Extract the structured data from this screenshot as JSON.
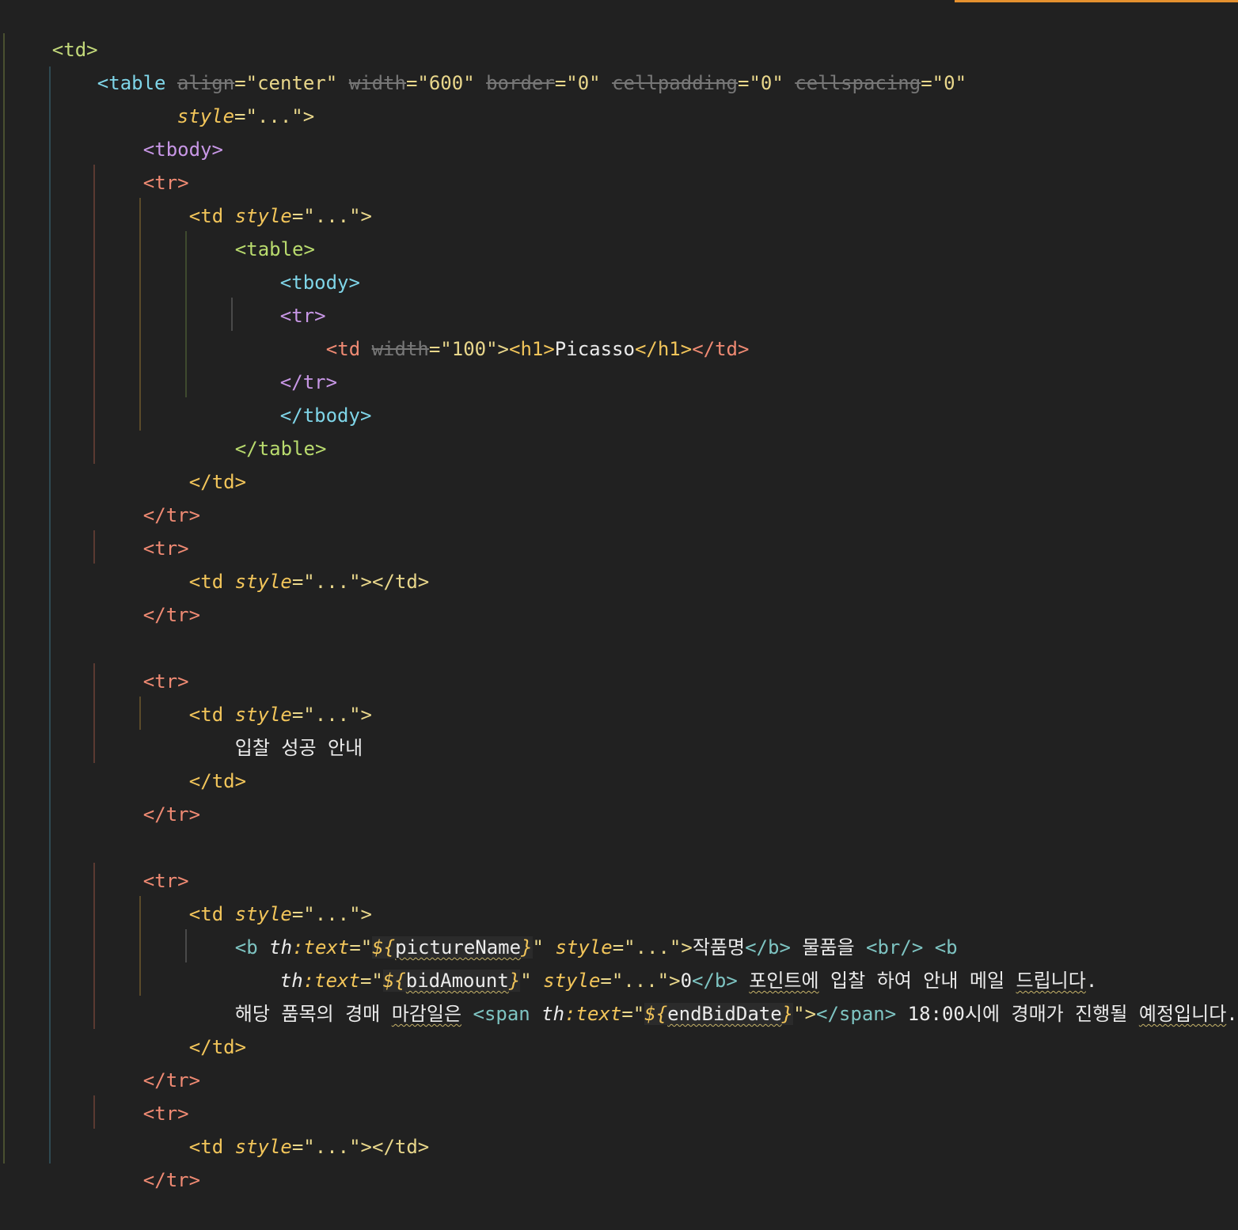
{
  "editor": {
    "lines": {
      "l1": "<td>",
      "l2a": "<table ",
      "l2b": "align",
      "l2c": "=\"center\" ",
      "l2d": "width",
      "l2e": "=\"600\" ",
      "l2f": "border",
      "l2g": "=\"0\" ",
      "l2h": "cellpadding",
      "l2i": "=\"0\" ",
      "l2j": "cellspacing",
      "l2k": "=\"0\"",
      "l3a": "style",
      "l3b": "=\"...\">",
      "l4": "<tbody>",
      "l5": "<tr>",
      "l6a": "<td ",
      "l6b": "style",
      "l6c": "=\"...\">",
      "l7": "<table>",
      "l8": "<tbody>",
      "l9": "<tr>",
      "l10a": "<td ",
      "l10b": "width",
      "l10c": "=\"100\">",
      "l10d": "<h1>",
      "l10e": "Picasso",
      "l10f": "</h1>",
      "l10g": "</td>",
      "l11": "</tr>",
      "l12": "</tbody>",
      "l13": "</table>",
      "l14": "</td>",
      "l15": "</tr>",
      "l16": "<tr>",
      "l17a": "<td ",
      "l17b": "style",
      "l17c": "=\"...\"></td>",
      "l18": "</tr>",
      "l19": "<tr>",
      "l20a": "<td ",
      "l20b": "style",
      "l20c": "=\"...\">",
      "l21": "입찰 성공 안내",
      "l22": "</td>",
      "l23": "</tr>",
      "l24": "<tr>",
      "l25a": "<td ",
      "l25b": "style",
      "l25c": "=\"...\">",
      "l26a": "<b ",
      "l26b": "th",
      "l26c": ":text",
      "l26d": "=\"",
      "l26e": "${",
      "l26f": "pictureName",
      "l26g": "}",
      "l26h": "\" ",
      "l26i": "style",
      "l26j": "=\"...\">",
      "l26k": "작품명",
      "l26l": "</b>",
      "l26m": " 물품을 ",
      "l26n": "<br/>",
      "l26o": " <b",
      "l27a": "th",
      "l27b": ":text",
      "l27c": "=\"",
      "l27d": "${",
      "l27e": "bidAmount",
      "l27f": "}",
      "l27g": "\" ",
      "l27h": "style",
      "l27i": "=\"...\">",
      "l27j": "0",
      "l27k": "</b>",
      "l27l": " ",
      "l27m": "포인트에",
      "l27n": " 입찰 하여 안내 메일 ",
      "l27o": "드립니다",
      "l27p": ".",
      "l28a": "해당 품목의 경매 ",
      "l28b": "마감일은",
      "l28c": " ",
      "l28d": "<span ",
      "l28e": "th",
      "l28f": ":text",
      "l28g": "=\"",
      "l28h": "${",
      "l28i": "endBidDate",
      "l28j": "}",
      "l28k": "\">",
      "l28l": "</span>",
      "l28m": " 18:00시에 경매가 진행될 ",
      "l28n": "예정입니다",
      "l28o": ".",
      "l29": "</td>",
      "l30": "</tr>",
      "l31": "<tr>",
      "l32a": "<td ",
      "l32b": "style",
      "l32c": "=\"...\"></td>",
      "l33": "</tr>"
    }
  },
  "colors": {
    "background": "#212121",
    "accent": "#e5912f"
  }
}
